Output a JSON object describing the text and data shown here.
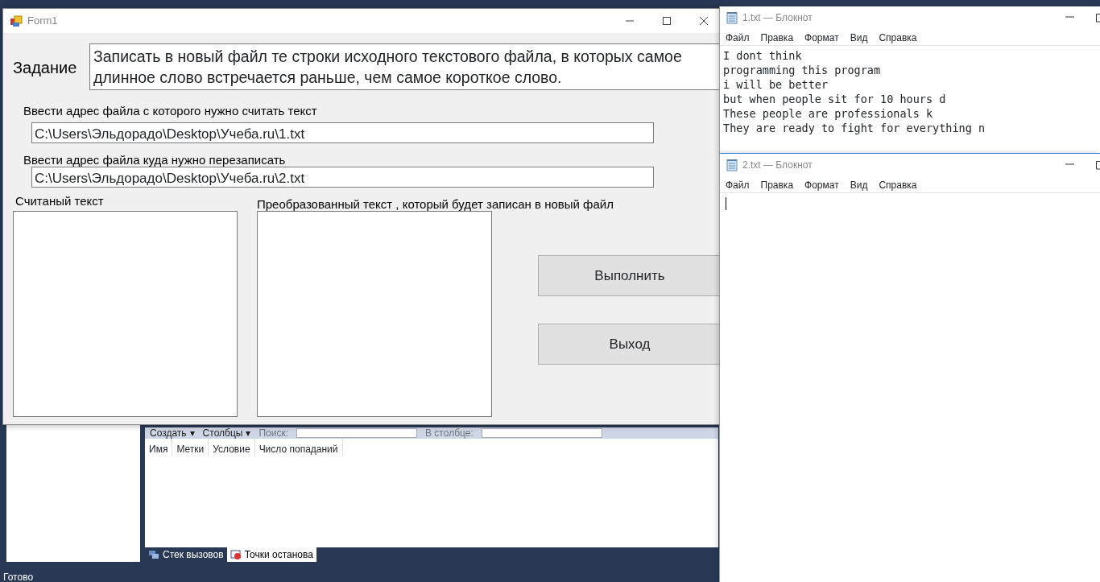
{
  "ide": {
    "toolbar": [
      {
        "kind": "dropdown",
        "label": "Создать",
        "caret": "▾"
      },
      {
        "kind": "dropdown",
        "label": "Столбцы",
        "caret": "▾"
      },
      {
        "kind": "search",
        "label": "Поиск:"
      },
      {
        "kind": "search",
        "label": "В столбце:"
      }
    ],
    "columns": [
      "Имя",
      "Метки",
      "Условие",
      "Число попаданий"
    ],
    "tabs": [
      {
        "label": "Стек вызовов",
        "selected": false
      },
      {
        "label": "Точки останова",
        "selected": true
      }
    ],
    "status": "Готово"
  },
  "form": {
    "title": "Form1",
    "task_label": "Задание",
    "task_text": "Записать в новый файл те строки исходного текстового файла, в которых самое длинное слово встречается раньше, чем самое короткое слово.",
    "source_label": "Ввести адрес файла с которого нужно считать текст",
    "source_path": "C:\\Users\\Эльдорадо\\Desktop\\Учеба.ru\\1.txt",
    "target_label": "Ввести адрес файла куда нужно перезаписать",
    "target_path": "C:\\Users\\Эльдорадо\\Desktop\\Учеба.ru\\2.txt",
    "read_label": "Считаный текст",
    "converted_label": "Преобразованный текст , который будет записан в новый файл",
    "buttons": [
      "Выполнить",
      "Выход"
    ]
  },
  "notepads": [
    {
      "title": "1.txt — Блокнот",
      "menu": [
        "Файл",
        "Правка",
        "Формат",
        "Вид",
        "Справка"
      ],
      "lines": [
        "I dont think",
        "programming this program",
        "i will be better",
        "but when people sit for 10 hours d",
        "These people are professionals k",
        "They are ready to fight for everything n"
      ]
    },
    {
      "title": "2.txt — Блокнот",
      "menu": [
        "Файл",
        "Правка",
        "Формат",
        "Вид",
        "Справка"
      ]
    }
  ]
}
